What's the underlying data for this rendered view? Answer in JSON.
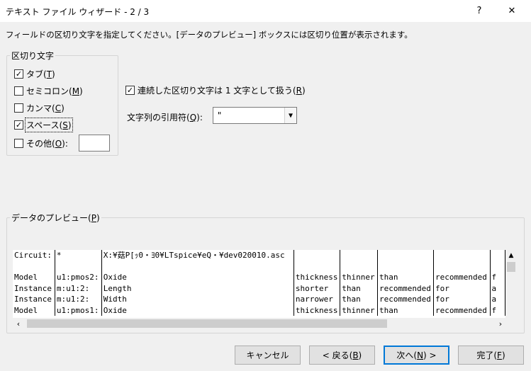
{
  "window": {
    "title": "テキスト ファイル ウィザード - 2 / 3",
    "help_glyph": "?",
    "close_glyph": "✕"
  },
  "instruction": "フィールドの区切り文字を指定してください。[データのプレビュー] ボックスには区切り位置が表示されます。",
  "delimiters": {
    "group_label": "区切り文字",
    "tab": {
      "label": "タブ(",
      "key": "T",
      "suffix": ")",
      "checked": true
    },
    "semicolon": {
      "label": "セミコロン(",
      "key": "M",
      "suffix": ")",
      "checked": false
    },
    "comma": {
      "label": "カンマ(",
      "key": "C",
      "suffix": ")",
      "checked": false
    },
    "space": {
      "label": "スペース(",
      "key": "S",
      "suffix": ")",
      "checked": true
    },
    "other": {
      "label": "その他(",
      "key": "O",
      "suffix": "):",
      "checked": false,
      "value": ""
    }
  },
  "consecutive": {
    "label": "連続した区切り文字は 1 文字として扱う(",
    "key": "R",
    "suffix": ")",
    "checked": true
  },
  "qualifier": {
    "label": "文字列の引用符(",
    "key": "Q",
    "suffix": "):",
    "value": "\""
  },
  "preview": {
    "group_label": "データのプレビュー(",
    "key": "P",
    "suffix": ")",
    "rows": [
      [
        "Circuit:",
        "*",
        "X:¥菇P[ｯ0・ﾖ0¥LTspice¥eQ・¥dev020010.asc",
        "",
        "",
        "",
        "",
        ""
      ],
      [
        "",
        "",
        "",
        "",
        "",
        "",
        "",
        ""
      ],
      [
        "Model",
        "u1:pmos2:",
        "Oxide",
        "thickness",
        "thinner",
        "than",
        "recommended",
        "f"
      ],
      [
        "Instance",
        "m:u1:2:",
        "Length",
        "shorter",
        "than",
        "recommended",
        "for",
        "a"
      ],
      [
        "Instance",
        "m:u1:2:",
        "Width",
        "narrower",
        "than",
        "recommended",
        "for",
        "a"
      ],
      [
        "Model",
        "u1:pmos1:",
        "Oxide",
        "thickness",
        "thinner",
        "than",
        "recommended",
        "f"
      ]
    ]
  },
  "buttons": {
    "cancel": "キャンセル",
    "back_prefix": "< 戻る(",
    "back_key": "B",
    "back_suffix": ")",
    "next_prefix": "次へ(",
    "next_key": "N",
    "next_suffix": ") >",
    "finish_prefix": "完了(",
    "finish_key": "F",
    "finish_suffix": ")"
  }
}
